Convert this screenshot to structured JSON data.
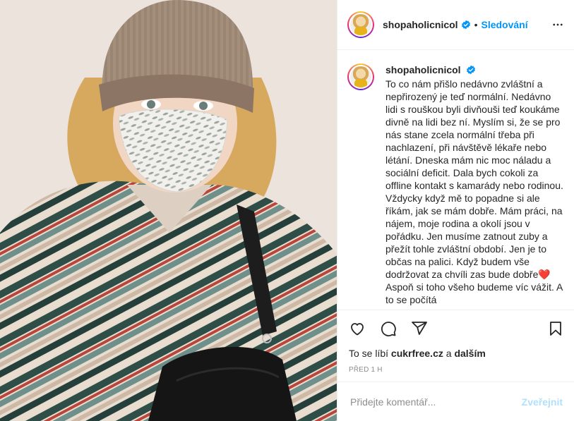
{
  "post": {
    "photo": {
      "alt": ""
    },
    "author": {
      "username": "shopaholicnicol",
      "verified_icon": "verified-badge-icon"
    },
    "header": {
      "separator": "•",
      "follow_label": "Sledování",
      "more_icon": "more-horizontal-icon"
    },
    "caption": {
      "username": "shopaholicnicol",
      "text_before_emoji": "To co nám přišlo nedávno zvláštní a nepřirozený je teď normální. Nedávno lidi s rouškou byli divňouši teď koukáme divně na lidi bez ní. Myslím si, že se pro nás stane zcela normální třeba při nachlazení, při návštěvě lékaře nebo létání. Dneska mám nic moc náladu a sociální deficit. Dala bych cokoli za offline kontakt s kamarády nebo rodinou. Vždycky když mě to popadne si ale říkám, jak se mám dobře. Mám práci, na nájem, moje rodina a okolí jsou v pořádku. Jen musíme zatnout zuby a přežít tohle zvláštní období. Jen je to občas na palici. Když budem vše dodržovat za chvíli zas bude dobře",
      "emoji": "❤️",
      "text_after_emoji": " Aspoň si toho všeho budeme víc vážit. A to se počítá"
    },
    "actions": {
      "like_icon": "heart-outline-icon",
      "comment_icon": "comment-bubble-icon",
      "share_icon": "paper-plane-icon",
      "save_icon": "bookmark-icon"
    },
    "likes": {
      "prefix": "To se líbí",
      "user": "cukrfree.cz",
      "joiner": "a",
      "others": "dalším"
    },
    "timestamp": "Před 1 h",
    "comment": {
      "placeholder": "Přidejte komentář...",
      "value": "",
      "publish_label": "Zveřejnit"
    },
    "colors": {
      "accent": "#0095f6",
      "publish_disabled": "#b2dffc",
      "border": "#efefef",
      "muted": "#8e8e8e"
    }
  }
}
